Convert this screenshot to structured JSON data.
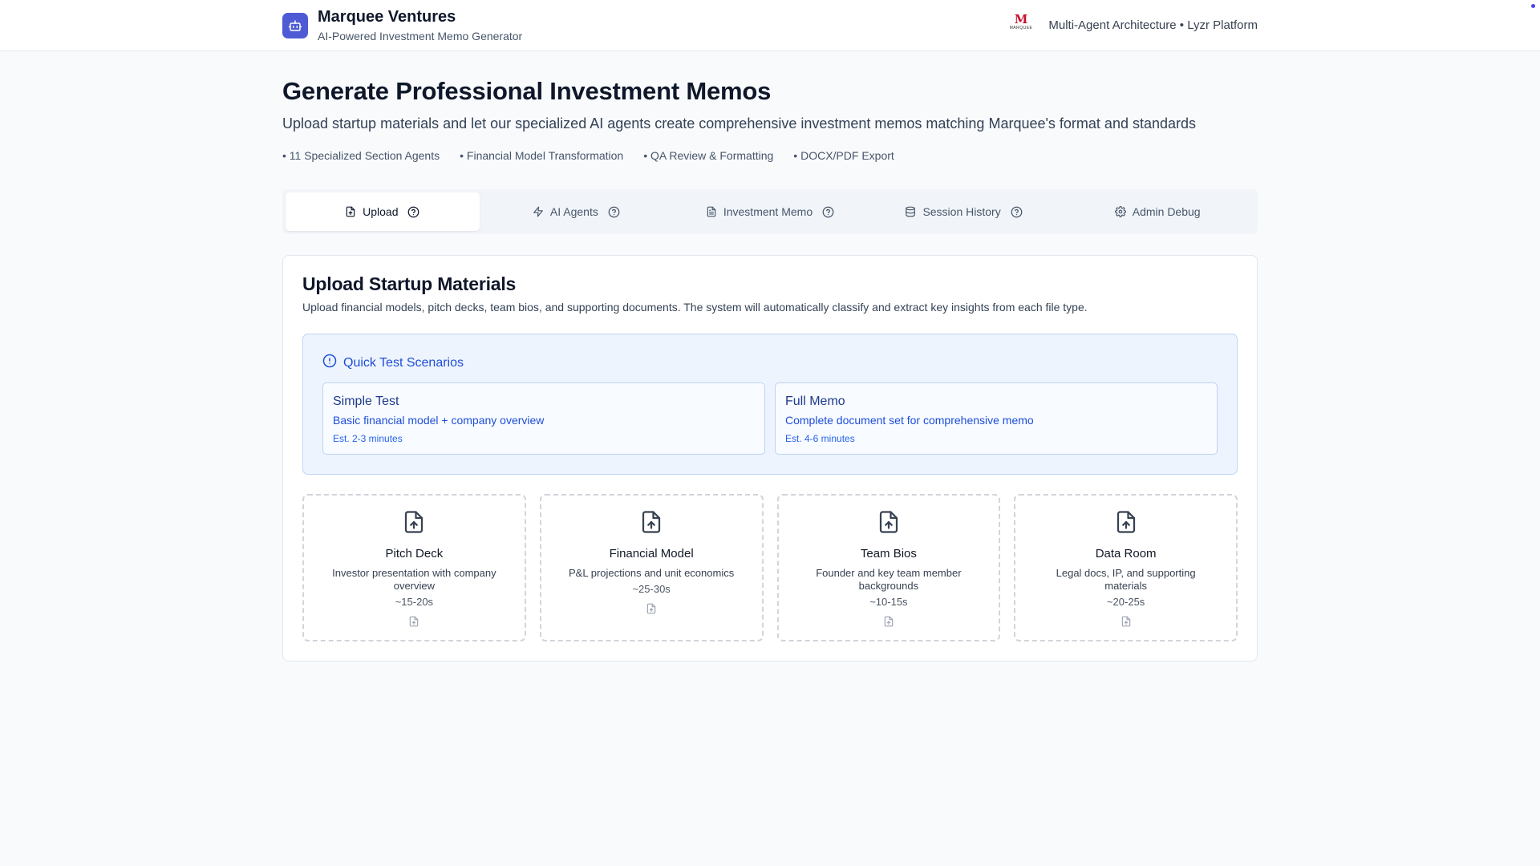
{
  "header": {
    "brand_name": "Marquee Ventures",
    "brand_tagline": "AI-Powered Investment Memo Generator",
    "partner_logo_text": "M",
    "partner_logo_word": "MARQUEE",
    "platform_text": "Multi-Agent Architecture • Lyzr Platform"
  },
  "hero": {
    "title": "Generate Professional Investment Memos",
    "subtitle": "Upload startup materials and let our specialized AI agents create comprehensive investment memos matching Marquee's format and standards",
    "features": [
      "• 11 Specialized Section Agents",
      "• Financial Model Transformation",
      "• QA Review & Formatting",
      "• DOCX/PDF Export"
    ]
  },
  "tabs": [
    {
      "label": "Upload",
      "icon": "file-upload-icon",
      "active": true
    },
    {
      "label": "AI Agents",
      "icon": "bolt-icon",
      "active": false
    },
    {
      "label": "Investment Memo",
      "icon": "document-icon",
      "active": false
    },
    {
      "label": "Session History",
      "icon": "database-icon",
      "active": false
    },
    {
      "label": "Admin Debug",
      "icon": "gear-icon",
      "active": false
    }
  ],
  "upload": {
    "title": "Upload Startup Materials",
    "description": "Upload financial models, pitch decks, team bios, and supporting documents. The system will automatically classify and extract key insights from each file type.",
    "quick_test": {
      "heading": "Quick Test Scenarios",
      "scenarios": [
        {
          "title": "Simple Test",
          "description": "Basic financial model + company overview",
          "estimate": "Est. 2-3 minutes"
        },
        {
          "title": "Full Memo",
          "description": "Complete document set for comprehensive memo",
          "estimate": "Est. 4-6 minutes"
        }
      ]
    },
    "dropzones": [
      {
        "title": "Pitch Deck",
        "description": "Investor presentation with company overview",
        "time": "~15-20s"
      },
      {
        "title": "Financial Model",
        "description": "P&L projections and unit economics",
        "time": "~25-30s"
      },
      {
        "title": "Team Bios",
        "description": "Founder and key team member backgrounds",
        "time": "~10-15s"
      },
      {
        "title": "Data Room",
        "description": "Legal docs, IP, and supporting materials",
        "time": "~20-25s"
      }
    ]
  },
  "colors": {
    "brand_accent": "#4f5bd5",
    "info_blue": "#1d4ed8",
    "partner_red": "#c8102e"
  }
}
